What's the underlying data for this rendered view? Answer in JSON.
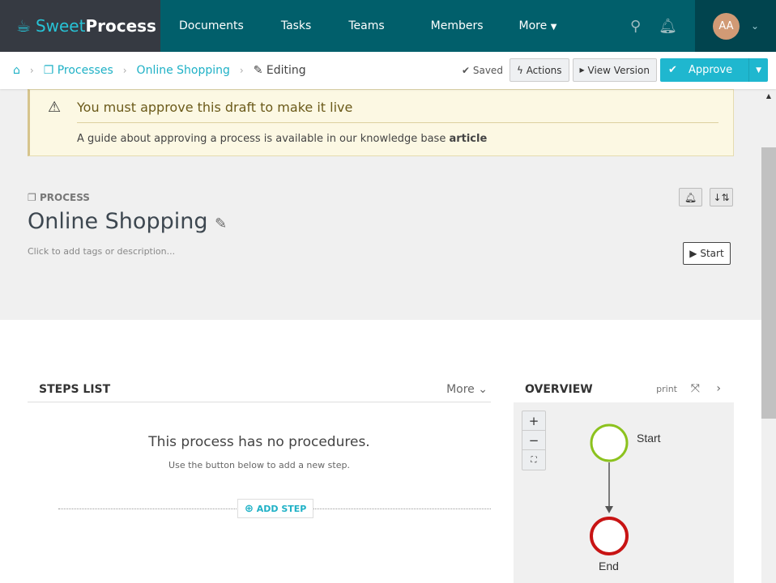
{
  "nav": {
    "brand_light": "Sweet",
    "brand_bold": "Process",
    "items": [
      "Documents",
      "Tasks",
      "Teams",
      "Members",
      "More"
    ],
    "avatar": "AA"
  },
  "breadcrumb": {
    "items": [
      "Processes",
      "Online Shopping"
    ],
    "current": "Editing"
  },
  "toolbar": {
    "saved": "Saved",
    "actions": "Actions",
    "view_version": "View Version",
    "approve": "Approve"
  },
  "alert": {
    "title": "You must approve this draft to make it live",
    "text": "A guide about approving a process is available in our knowledge base ",
    "link": "article"
  },
  "process": {
    "label": "PROCESS",
    "title": "Online Shopping",
    "description_placeholder": "Click to add tags or description...",
    "start": "Start"
  },
  "steps": {
    "header": "STEPS LIST",
    "more": "More",
    "empty_title": "This process has no procedures.",
    "empty_hint": "Use the button below to add a new step.",
    "add_step": "ADD STEP"
  },
  "overview": {
    "header": "OVERVIEW",
    "print": "print",
    "start_node": "Start",
    "end_node": "End"
  },
  "colors": {
    "accent": "#1fb7cf",
    "nav": "#015f6b",
    "start": "#8cc21e",
    "end": "#c81414"
  }
}
